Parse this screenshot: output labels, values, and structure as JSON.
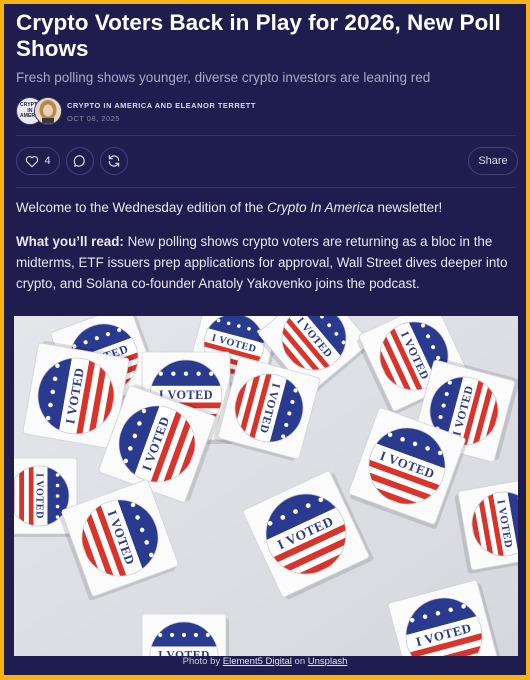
{
  "article": {
    "title": "Crypto Voters Back in Play for 2026, New Poll Shows",
    "subtitle": "Fresh polling shows younger, diverse crypto investors are leaning red",
    "byline": "CRYPTO IN AMERICA AND ELEANOR TERRETT",
    "date": "OCT 08, 2025",
    "brand_logo_text": "CRYPTO IN AMERICA"
  },
  "actions": {
    "like_count": "4",
    "share_label": "Share",
    "icons": [
      "heart-icon",
      "comment-icon",
      "restack-icon"
    ]
  },
  "body": {
    "p1_pre": "Welcome to the Wednesday edition of the ",
    "p1_em": "Crypto In America",
    "p1_post": " newsletter!",
    "p2_strong": "What you’ll read:",
    "p2_text": " New polling shows crypto voters are returning as a bloc in the midterms, ETF issuers prep applications for approval, Wall Street dives deeper into crypto, and Solana co-founder Anatoly Yakovenko joins the podcast."
  },
  "photo": {
    "sticker_text": "I VOTED",
    "caption_pre": "Photo by ",
    "photographer": "Element5 Digital",
    "caption_mid": " on ",
    "source": "Unsplash"
  },
  "colors": {
    "page_border": "#f7b216",
    "background": "#1f1d4e",
    "sticker_blue": "#2a3a8f",
    "sticker_red": "#d8342c"
  }
}
